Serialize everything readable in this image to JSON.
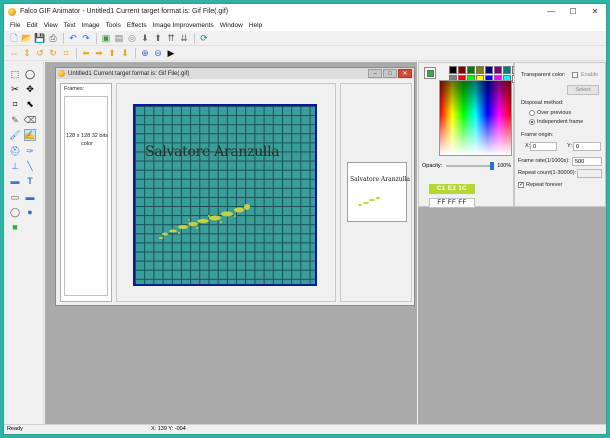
{
  "window": {
    "title": "Falco GIF Animator - Untitled1  Current target format is: Gif File(.gif)",
    "minimize_icon": "minimize-icon",
    "maximize_icon": "maximize-icon",
    "close_icon": "close-icon"
  },
  "menubar": [
    "File",
    "Edit",
    "View",
    "Text",
    "Image",
    "Tools",
    "Effects",
    "Image Improvements",
    "Window",
    "Help"
  ],
  "toolbar1": [
    "new-document-icon",
    "open-folder-icon",
    "save-icon",
    "print-icon",
    "undo-icon",
    "redo-icon",
    "insert-frame-icon",
    "delete-frame-icon",
    "color-wheel-icon",
    "move-down-icon",
    "move-up-icon",
    "move-up-double-icon",
    "move-down-double-icon",
    "refresh-icon"
  ],
  "toolbar2": [
    "flip-horizontal-icon",
    "flip-vertical-icon",
    "rotate-left-icon",
    "rotate-right-icon",
    "crop-icon",
    "arrow-left-icon",
    "arrow-right-icon",
    "arrow-up-icon",
    "arrow-down-icon",
    "zoom-in-icon",
    "zoom-out-icon",
    "play-icon"
  ],
  "tools": [
    "select-rect-icon",
    "select-ellipse-icon",
    "lasso-icon",
    "move-icon",
    "crop-icon",
    "pointer-icon",
    "pencil-icon",
    "brush-icon",
    "eraser-icon",
    "fill-icon",
    "eyedropper-icon",
    "spray-icon",
    "line-icon",
    "text-icon",
    "rectangle-icon",
    "filled-rectangle-icon",
    "ellipse-icon",
    "filled-ellipse-icon",
    "filled-square-icon"
  ],
  "document": {
    "title": "Untitled1  Current target format is: Gif File(.gif)",
    "frames_label": "Frames:",
    "frame_info": "128 x 128 32 bits color",
    "canvas_text": "Salvatore Aranzulla",
    "preview_text": "Salvatore Aranzulla"
  },
  "color_panel": {
    "palette": [
      "#000000",
      "#7f0000",
      "#007f00",
      "#7f7f00",
      "#00007f",
      "#7f007f",
      "#007f7f",
      "#c0c0c0",
      "#808080",
      "#ff0000",
      "#00ff00",
      "#ffff00",
      "#0000ff",
      "#ff00ff",
      "#00ffff",
      "#ffffff"
    ],
    "selected_color": "#2eb04a",
    "opacity_label": "Opacity:",
    "opacity_value": "100%",
    "opacity_fraction": 1.0,
    "hex_primary": "C1 E3 1C",
    "hex_secondary": "FF FF FF"
  },
  "properties": {
    "transparent_label": "Transparent color:",
    "enable_label": "Enable",
    "select_button": "Select",
    "disposal_label": "Disposal method:",
    "over_previous": "Over previous",
    "independent_frame": "Independent frame",
    "frame_origin": "Frame origin:",
    "x_label": "X:",
    "x_value": "0",
    "y_label": "Y:",
    "y_value": "0",
    "frame_rate_label": "Frame rate(1/1000s):",
    "frame_rate_value": "500",
    "repeat_count_label": "Repeat count(1-30000):",
    "repeat_forever_label": "Repeat forever"
  },
  "status": {
    "left": "Ready",
    "coords": "X: 139 Y: -004"
  }
}
